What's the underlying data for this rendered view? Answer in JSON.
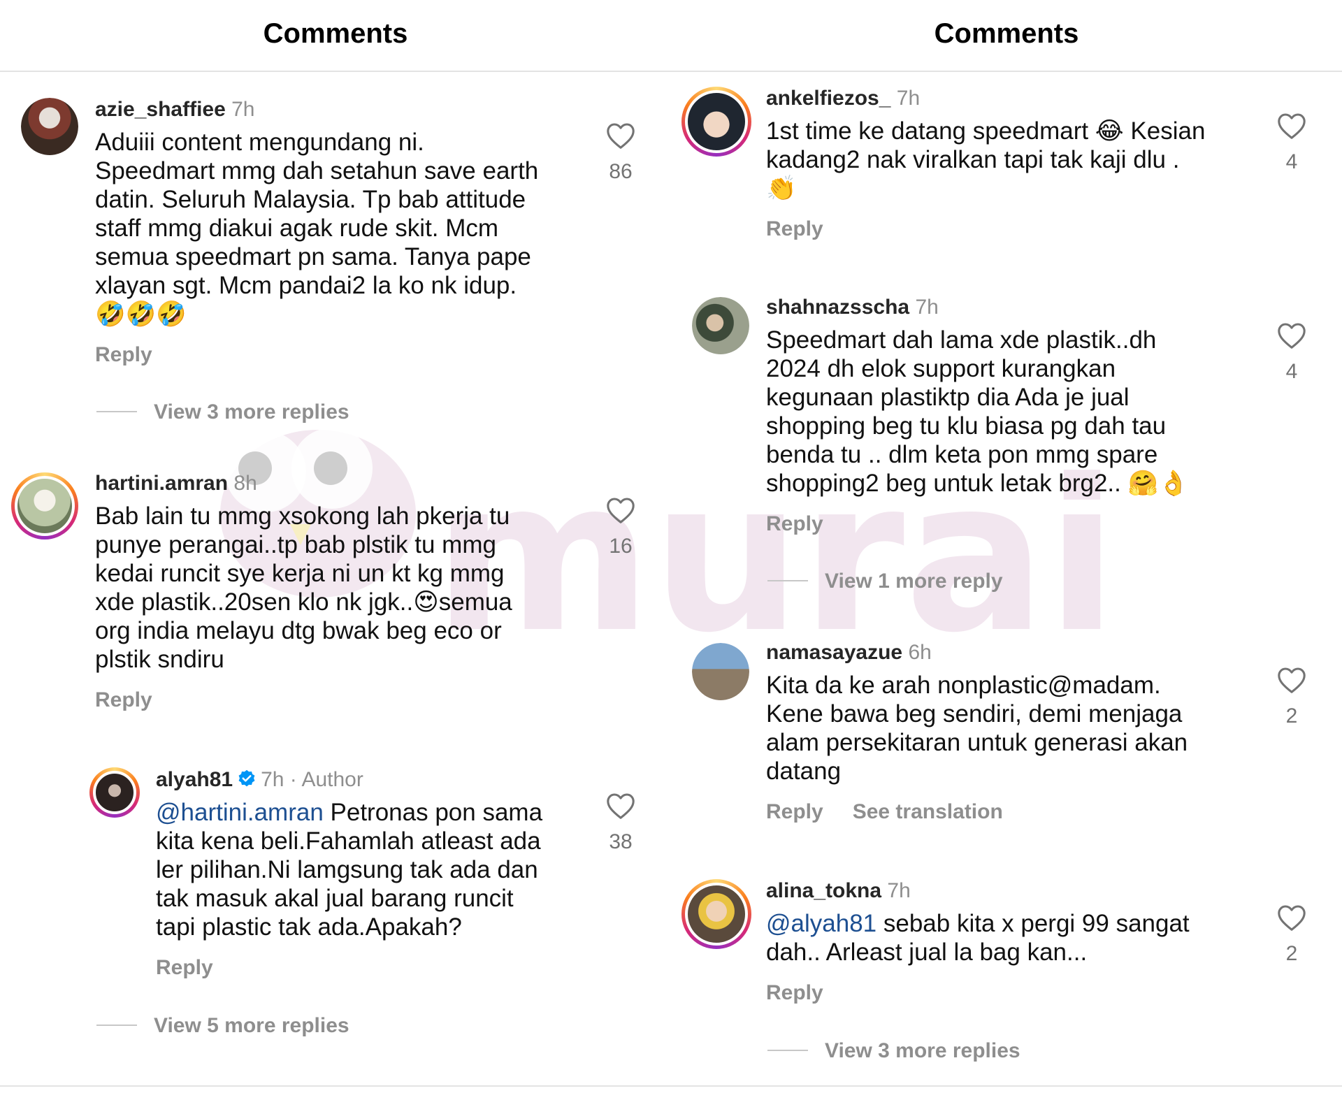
{
  "header": {
    "left_title": "Comments",
    "right_title": "Comments"
  },
  "watermark": {
    "text": "murai",
    "color": "#e7cfe0"
  },
  "left_comments": [
    {
      "username": "azie_shaffiee",
      "time": "7h",
      "text": "Aduiii content mengundang ni.\nSpeedmart mmg dah setahun save earth\ndatin. Seluruh Malaysia. Tp bab attitude\nstaff mmg diakui agak rude skit. Mcm\nsemua speedmart pn sama. Tanya pape\nxlayan sgt. Mcm pandai2 la ko nk idup.\n🤣🤣🤣",
      "likes": "86",
      "reply_label": "Reply",
      "view_more": "View 3 more replies"
    },
    {
      "username": "hartini.amran",
      "time": "8h",
      "text": "Bab lain tu mmg xsokong lah pkerja tu\npunye perangai..tp bab plstik tu mmg\nkedai runcit sye kerja ni un kt kg mmg\nxde plastik..20sen klo nk jgk..😍semua\norg india melayu dtg bwak beg eco or\nplstik sndiru",
      "likes": "16",
      "reply_label": "Reply"
    },
    {
      "username": "alyah81",
      "time": "7h · Author",
      "mention": "@hartini.amran",
      "text": " Petronas pon sama\nkita kena beli.Fahamlah atleast ada\nler pilihan.Ni lamgsung tak ada dan\ntak masuk akal jual barang runcit\ntapi plastic tak ada.Apakah?",
      "likes": "38",
      "reply_label": "Reply",
      "view_more": "View 5 more replies"
    }
  ],
  "right_comments": [
    {
      "username": "ankelfiezos_",
      "time": "7h",
      "text": "1st time ke datang speedmart 😂  Kesian\nkadang2 nak viralkan tapi tak kaji dlu .\n👏",
      "likes": "4",
      "reply_label": "Reply"
    },
    {
      "username": "shahnazsscha",
      "time": "7h",
      "text": "Speedmart dah lama xde plastik..dh\n2024 dh elok support kurangkan\nkegunaan plastiktp dia Ada je jual\nshopping beg tu klu biasa pg dah tau\nbenda tu .. dlm keta pon mmg spare\nshopping2 beg untuk letak brg2.. 🤗👌",
      "likes": "4",
      "reply_label": "Reply",
      "view_more": "View 1 more reply"
    },
    {
      "username": "namasayazue",
      "time": "6h",
      "text": "Kita da ke arah nonplastic@madam.\nKene bawa beg sendiri, demi menjaga\nalam persekitaran untuk generasi akan\ndatang",
      "likes": "2",
      "reply_label": "Reply",
      "translate_label": "See translation"
    },
    {
      "username": "alina_tokna",
      "time": "7h",
      "mention": "@alyah81",
      "text": " sebab kita x pergi 99 sangat\ndah.. Arleast jual la bag kan...",
      "likes": "2",
      "reply_label": "Reply",
      "view_more": "View 3 more replies"
    }
  ],
  "icons": {
    "like": "heart-outline-icon",
    "verified": "verified-badge-icon"
  },
  "colors": {
    "mention": "#1d4f91",
    "verified": "#0095f6",
    "muted": "#8e8e8e"
  }
}
